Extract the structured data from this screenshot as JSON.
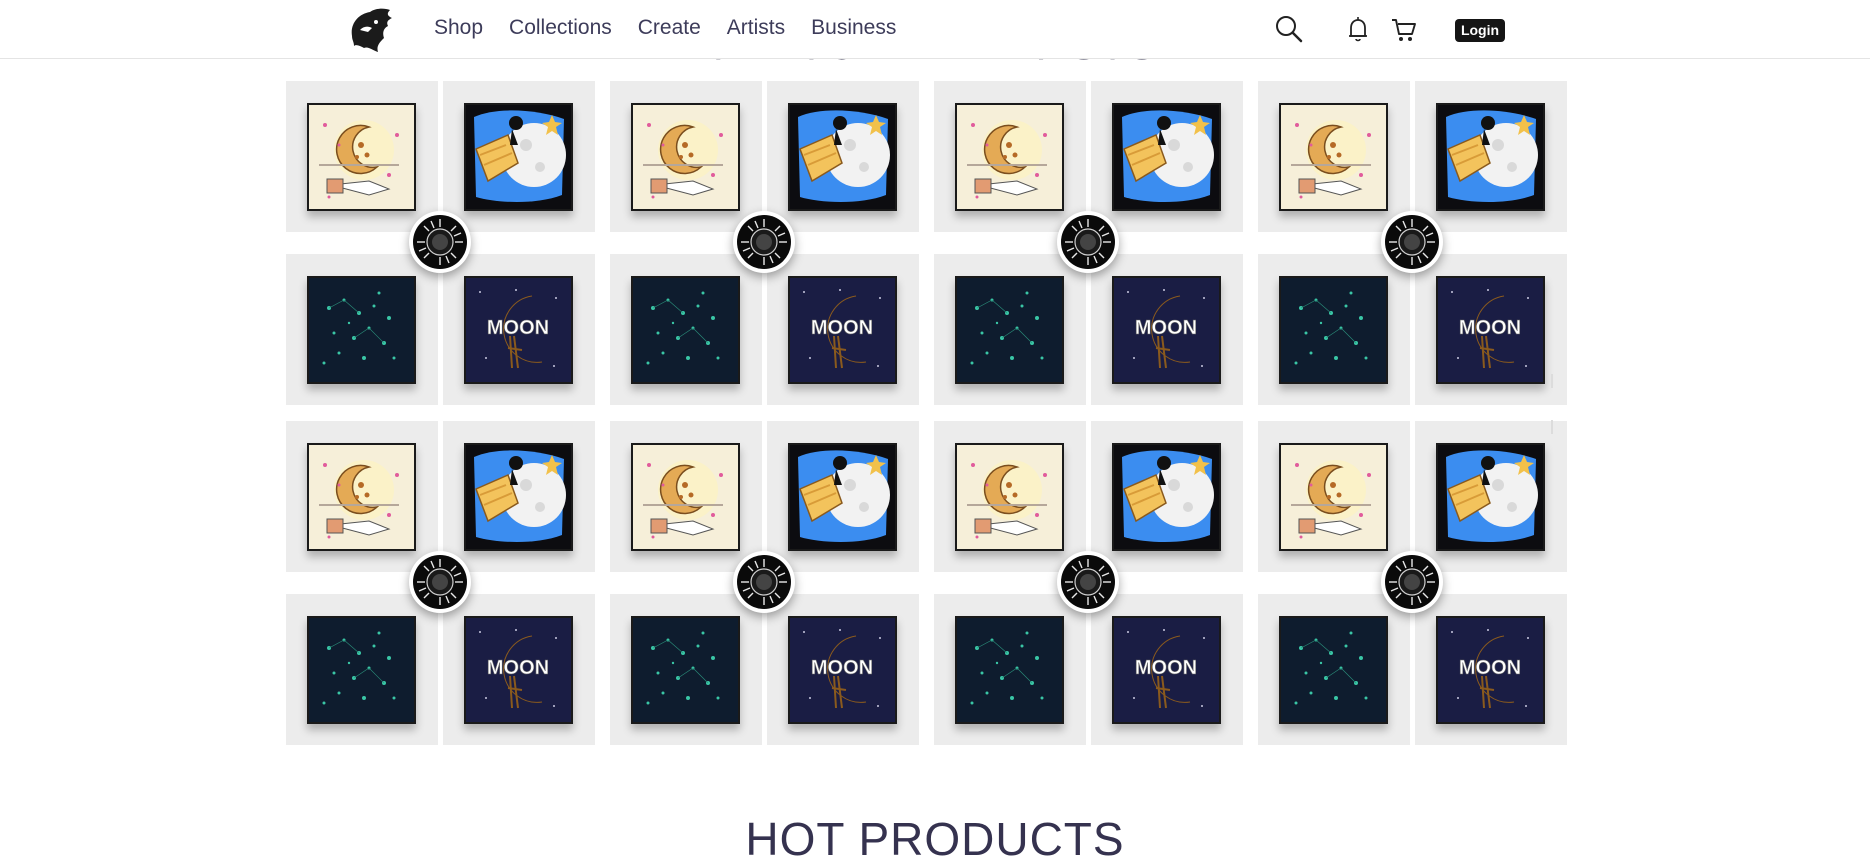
{
  "nav": {
    "items": [
      {
        "label": "Shop"
      },
      {
        "label": "Collections"
      },
      {
        "label": "Create"
      },
      {
        "label": "Artists"
      },
      {
        "label": "Business"
      }
    ],
    "icons": [
      "search-icon",
      "bell-icon",
      "cart-icon"
    ],
    "login_label": "Login"
  },
  "sections": {
    "featured_title": "FEATURED ARTISTS",
    "hot_title": "HOT PRODUCTS"
  },
  "artworks": {
    "moon_text": "MOON"
  },
  "colors": {
    "tile_bg": "#ececec",
    "title": "#35324f",
    "nav_text": "#3d3c5a",
    "login_bg": "#151515"
  }
}
